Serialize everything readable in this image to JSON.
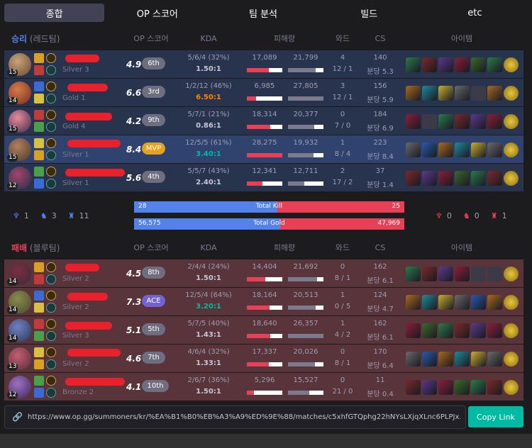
{
  "tabs": [
    "종합",
    "OP 스코어",
    "팀 분석",
    "빌드",
    "etc"
  ],
  "win_header": {
    "result": "승리",
    "team": "(레드팀)",
    "cols": [
      "OP 스코어",
      "KDA",
      "피해량",
      "와드",
      "CS",
      "아이템"
    ]
  },
  "lose_header": {
    "result": "패배",
    "team": "(블루팀)",
    "cols": [
      "OP 스코어",
      "KDA",
      "피해량",
      "와드",
      "CS",
      "아이템"
    ]
  },
  "win_players": [
    {
      "level": "15",
      "tier": "Silver 3",
      "score": "4.9",
      "badge": "6th",
      "kda": "5/6/4 (32%)",
      "ratio": "1.50:1",
      "dmg_dealt": "17,089",
      "dmg_taken": "21,799",
      "dealt_pct": 0.61,
      "taken_pct": 0.78,
      "wards": "4",
      "ward_detail": "12 / 1",
      "cs": "140",
      "cs_min": "분당 5.3",
      "ratio_color": "#c6c6d4"
    },
    {
      "level": "14",
      "tier": "Gold 1",
      "score": "6.6",
      "badge": "3rd",
      "kda": "1/2/12 (46%)",
      "ratio": "6.50:1",
      "dmg_dealt": "6,985",
      "dmg_taken": "27,805",
      "dealt_pct": 0.25,
      "taken_pct": 1.0,
      "wards": "3",
      "ward_detail": "12 / 1",
      "cs": "156",
      "cs_min": "분당 5.9",
      "ratio_color": "#ff8200"
    },
    {
      "level": "15",
      "tier": "Gold 4",
      "score": "4.2",
      "badge": "9th",
      "kda": "5/7/1 (21%)",
      "ratio": "0.86:1",
      "dmg_dealt": "18,314",
      "dmg_taken": "20,377",
      "dealt_pct": 0.65,
      "taken_pct": 0.73,
      "wards": "0",
      "ward_detail": "7 / 0",
      "cs": "184",
      "cs_min": "분당 6.9",
      "ratio_color": "#c6c6d4"
    },
    {
      "level": "15",
      "tier": "Silver 1",
      "score": "8.4",
      "badge": "MVP",
      "kda": "12/5/5 (61%)",
      "ratio": "3.40:1",
      "dmg_dealt": "28,275",
      "dmg_taken": "19,932",
      "dealt_pct": 1.0,
      "taken_pct": 0.71,
      "wards": "1",
      "ward_detail": "8 / 4",
      "cs": "223",
      "cs_min": "분당 8.4",
      "ratio_color": "#00bba3",
      "me": true
    },
    {
      "level": "12",
      "tier": "Silver 1",
      "score": "5.6",
      "badge": "4th",
      "kda": "5/5/7 (43%)",
      "ratio": "2.40:1",
      "dmg_dealt": "12,341",
      "dmg_taken": "12,711",
      "dealt_pct": 0.44,
      "taken_pct": 0.46,
      "wards": "2",
      "ward_detail": "17 / 2",
      "cs": "37",
      "cs_min": "분당 1.4",
      "ratio_color": "#c6c6d4"
    }
  ],
  "lose_players": [
    {
      "level": "14",
      "tier": "Silver 2",
      "score": "4.5",
      "badge": "8th",
      "kda": "2/4/4 (24%)",
      "ratio": "1.50:1",
      "dmg_dealt": "14,404",
      "dmg_taken": "21,692",
      "dealt_pct": 0.51,
      "taken_pct": 0.82,
      "wards": "0",
      "ward_detail": "8 / 1",
      "cs": "162",
      "cs_min": "분당 6.1",
      "ratio_color": "#c6c6d4"
    },
    {
      "level": "14",
      "tier": "Silver 2",
      "score": "7.3",
      "badge": "ACE",
      "kda": "12/5/4 (64%)",
      "ratio": "3.20:1",
      "dmg_dealt": "18,164",
      "dmg_taken": "20,513",
      "dealt_pct": 0.64,
      "taken_pct": 0.78,
      "wards": "1",
      "ward_detail": "0 / 5",
      "cs": "124",
      "cs_min": "분당 4.7",
      "ratio_color": "#00bba3"
    },
    {
      "level": "14",
      "tier": "Silver 3",
      "score": "5.1",
      "badge": "5th",
      "kda": "5/7/5 (40%)",
      "ratio": "1.43:1",
      "dmg_dealt": "18,640",
      "dmg_taken": "26,357",
      "dealt_pct": 0.66,
      "taken_pct": 1.0,
      "wards": "1",
      "ward_detail": "4 / 2",
      "cs": "162",
      "cs_min": "분당 6.1",
      "ratio_color": "#c6c6d4"
    },
    {
      "level": "13",
      "tier": "Silver 2",
      "score": "4.6",
      "badge": "7th",
      "kda": "4/6/4 (32%)",
      "ratio": "1.33:1",
      "dmg_dealt": "17,337",
      "dmg_taken": "20,026",
      "dealt_pct": 0.61,
      "taken_pct": 0.76,
      "wards": "0",
      "ward_detail": "8 / 1",
      "cs": "170",
      "cs_min": "분당 6.4",
      "ratio_color": "#c6c6d4"
    },
    {
      "level": "12",
      "tier": "Bronze 2",
      "score": "4.1",
      "badge": "10th",
      "kda": "2/6/7 (36%)",
      "ratio": "1.50:1",
      "dmg_dealt": "5,296",
      "dmg_taken": "15,527",
      "dealt_pct": 0.19,
      "taken_pct": 0.59,
      "wards": "0",
      "ward_detail": "21 / 0",
      "cs": "11",
      "cs_min": "분당 0.4",
      "ratio_color": "#c6c6d4"
    }
  ],
  "summary": {
    "blue_objectives": [
      "1",
      "3",
      "11"
    ],
    "red_objectives": [
      "0",
      "0",
      "1"
    ],
    "kill_label": "Total Kill",
    "kill_blue": "28",
    "kill_red": "25",
    "kill_blue_pct": 0.53,
    "gold_label": "Total Gold",
    "gold_blue": "56,575",
    "gold_red": "47,969",
    "gold_blue_pct": 0.54
  },
  "link": {
    "url": "https://www.op.gg/summoners/kr/%EA%B1%B0%EB%A3%A9%ED%9E%88/matches/c5xhfGTQphg22hNYsLXjqXLnc6PLPJx...",
    "button": "Copy Link"
  },
  "colors": {
    "blue": "#5383e8",
    "red": "#e84057",
    "teal": "#00bba3",
    "mvp": "#e6a21e",
    "ace": "#7261d1"
  }
}
